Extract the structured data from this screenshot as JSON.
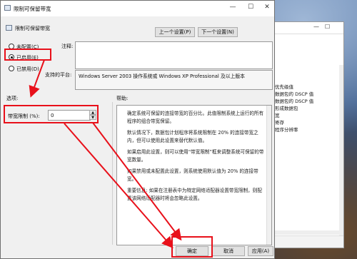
{
  "window": {
    "title": "限制可保留带宽",
    "min": "—",
    "max": "☐",
    "close": "✕"
  },
  "policy": {
    "name": "限制可保留带宽"
  },
  "nav": {
    "prev": "上一个设置(P)",
    "next": "下一个设置(N)"
  },
  "options": {
    "not_configured": "未配置(C)",
    "enabled": "已启用(E)",
    "disabled": "已禁用(D)",
    "selected": "enabled"
  },
  "comment_label": "注释:",
  "supported_label": "支持的平台:",
  "supported_value": "Windows Server 2003 操作系统或 Windows XP Professional 及以上版本",
  "options_header": "选项:",
  "help_header": "帮助:",
  "bandwidth": {
    "label": "带宽限制 (%):",
    "value": "0"
  },
  "help_text": [
    "确定系统可保留的连接带宽的百分比。此值限制系统上运行的所有程序的组合带宽保留。",
    "默认情况下，数据包计划程序将系统限制在 20% 的连接带宽之内，但可以使用此设置来替代默认值。",
    "如果启用此设置，则可以使用“带宽限制”框来调整系统可保留的带宽数量。",
    "如果禁用或未配置此设置，则系统使用默认值为 20% 的连接带宽。",
    "重要信息: 如果在注册表中为特定网络适配器设置带宽限制，则配置该网络适配器时将会忽略此设置。"
  ],
  "buttons": {
    "ok": "确定",
    "cancel": "取消",
    "apply": "应用(A)"
  },
  "bg_window": {
    "rows": [
      "优先级值",
      "数据包的 DSCP 值",
      "数据包的 DSCP 值",
      "形成数据包",
      "宽",
      "寄存",
      "程序分辨率"
    ]
  },
  "colors": {
    "annotation": "#e8101a"
  }
}
